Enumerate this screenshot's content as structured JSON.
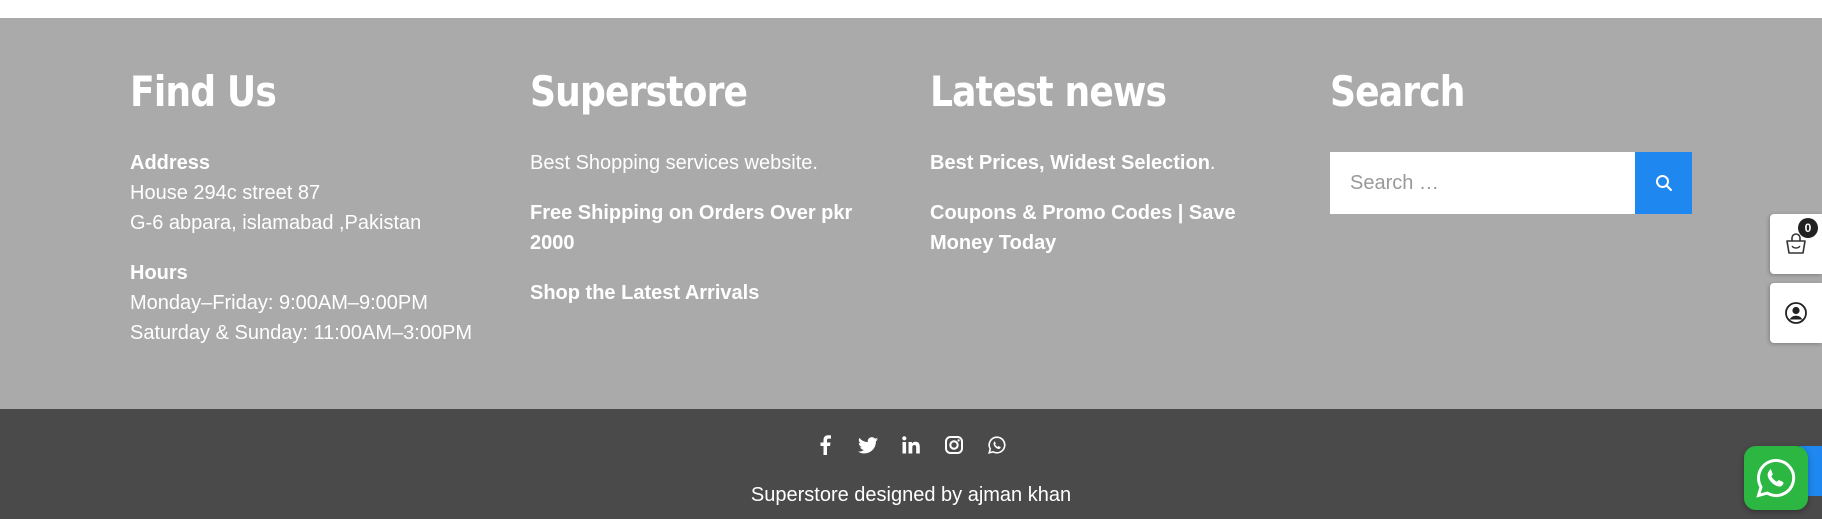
{
  "find_us": {
    "heading": "Find Us",
    "address_label": "Address",
    "address_line1": "House 294c street 87",
    "address_line2": "G-6 abpara, islamabad ,Pakistan",
    "hours_label": "Hours",
    "hours_line1": "Monday–Friday: 9:00AM–9:00PM",
    "hours_line2": "Saturday & Sunday: 11:00AM–3:00PM"
  },
  "superstore": {
    "heading": "Superstore",
    "tagline": "Best Shopping services website.",
    "shipping": "Free Shipping on Orders Over pkr 2000",
    "arrivals": "Shop the Latest Arrivals"
  },
  "latest_news": {
    "heading": "Latest news",
    "item1": "Best Prices, Widest Selection",
    "item1_suffix": ".",
    "item2": "Coupons & Promo Codes | Save Money Today"
  },
  "search": {
    "heading": "Search",
    "placeholder": "Search …",
    "button_icon": "search-icon"
  },
  "social": {
    "icons": [
      "facebook-icon",
      "twitter-icon",
      "linkedin-icon",
      "instagram-icon",
      "whatsapp-icon"
    ]
  },
  "copyright": "Superstore designed by ajman khan",
  "side": {
    "cart_count": "0",
    "cart_icon": "cart-icon",
    "account_icon": "user-icon"
  },
  "colors": {
    "footer_bg": "#aaaaaa",
    "bottom_bar_bg": "#4a4a4a",
    "accent_blue": "#1e88f0",
    "whatsapp_green": "#2bb741"
  }
}
